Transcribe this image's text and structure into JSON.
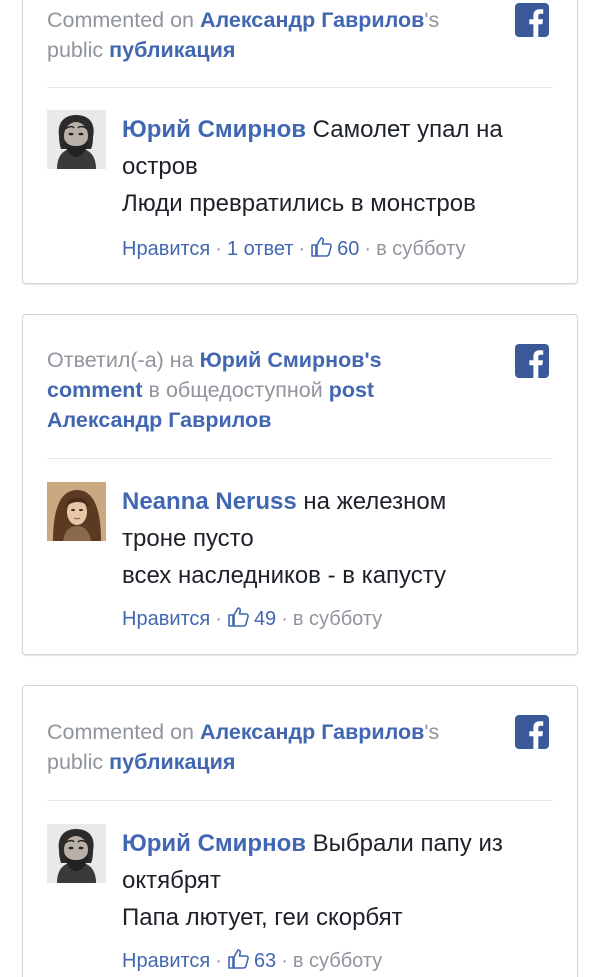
{
  "colors": {
    "link": "#4267b2",
    "muted": "#90949c",
    "text": "#1d2129",
    "facebook": "#3b5998",
    "border": "#d3d6db"
  },
  "cards": [
    {
      "header": {
        "prefix": "Commented on ",
        "name": "Александр Гаврилов",
        "suffix": "'s",
        "line2_prefix": "public ",
        "link": "публикация"
      },
      "icon": "facebook-icon",
      "comment": {
        "author": "Юрий Смирнов",
        "line1": "Самолет упал на",
        "line2": "остров",
        "line3": "Люди превратились в монстров"
      },
      "meta": {
        "like": "Нравится",
        "replies": "1 ответ",
        "likes": "60",
        "time": "в субботу"
      }
    },
    {
      "header": {
        "prefix": "Ответил(-а) на ",
        "name": "Юрий Смирнов's",
        "line2_link": "comment",
        "line2_text": " в общедоступной ",
        "line2_link2": "post",
        "line3": "Александр Гаврилов"
      },
      "icon": "facebook-icon",
      "comment": {
        "author": "Neanna Neruss",
        "line1": "на железном",
        "line2": "троне пусто",
        "line3": "всех наследников - в капусту"
      },
      "meta": {
        "like": "Нравится",
        "likes": "49",
        "time": "в субботу"
      }
    },
    {
      "header": {
        "prefix": "Commented on ",
        "name": "Александр Гаврилов",
        "suffix": "'s",
        "line2_prefix": "public ",
        "link": "публикация"
      },
      "icon": "facebook-icon",
      "comment": {
        "author": "Юрий Смирнов",
        "line1": "Выбрали папу из",
        "line2": "октябрят",
        "line3": "Папа лютует, геи скорбят"
      },
      "meta": {
        "like": "Нравится",
        "likes": "63",
        "time": "в субботу"
      }
    }
  ]
}
